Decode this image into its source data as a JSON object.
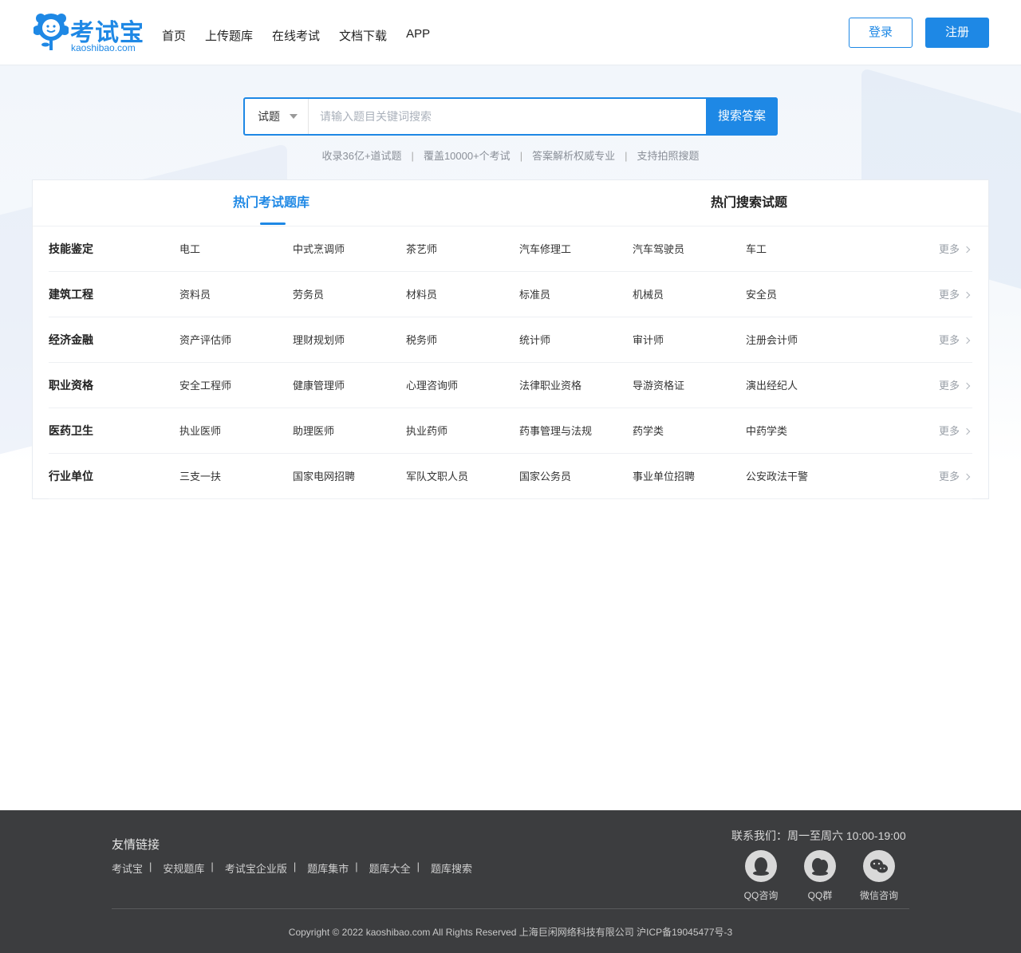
{
  "header": {
    "logo_text": "考试宝",
    "logo_domain": "kaoshibao.com",
    "nav": [
      "首页",
      "上传题库",
      "在线考试",
      "文档下载",
      "APP"
    ],
    "login_label": "登录",
    "register_label": "注册"
  },
  "search": {
    "type_label": "试题",
    "placeholder": "请输入题目关键词搜索",
    "button_label": "搜索答案",
    "features": [
      "收录36亿+道试题",
      "覆盖10000+个考试",
      "答案解析权威专业",
      "支持拍照搜题"
    ],
    "separator": "|"
  },
  "tabs": {
    "active": "热门考试题库",
    "other": "热门搜索试题"
  },
  "more_label": "更多",
  "categories": [
    {
      "title": "技能鉴定",
      "items": [
        "电工",
        "中式烹调师",
        "茶艺师",
        "汽车修理工",
        "汽车驾驶员",
        "车工"
      ]
    },
    {
      "title": "建筑工程",
      "items": [
        "资料员",
        "劳务员",
        "材料员",
        "标准员",
        "机械员",
        "安全员"
      ]
    },
    {
      "title": "经济金融",
      "items": [
        "资产评估师",
        "理财规划师",
        "税务师",
        "统计师",
        "审计师",
        "注册会计师"
      ]
    },
    {
      "title": "职业资格",
      "items": [
        "安全工程师",
        "健康管理师",
        "心理咨询师",
        "法律职业资格",
        "导游资格证",
        "演出经纪人"
      ]
    },
    {
      "title": "医药卫生",
      "items": [
        "执业医师",
        "助理医师",
        "执业药师",
        "药事管理与法规",
        "药学类",
        "中药学类"
      ]
    },
    {
      "title": "行业单位",
      "items": [
        "三支一扶",
        "国家电网招聘",
        "军队文职人员",
        "国家公务员",
        "事业单位招聘",
        "公安政法干警"
      ]
    }
  ],
  "footer": {
    "links_title": "友情链接",
    "links": [
      "考试宝",
      "安规题库",
      "考试宝企业版",
      "题库集市",
      "题库大全",
      "题库搜索"
    ],
    "link_separator": "|",
    "contact": "联系我们：周一至周六 10:00-19:00",
    "social": [
      "QQ咨询",
      "QQ群",
      "微信咨询"
    ],
    "copyright": "Copyright © 2022 kaoshibao.com All Rights Reserved 上海巨闲网络科技有限公司 沪ICP备19045477号-3"
  },
  "colors": {
    "accent": "#1e88e5",
    "footer_bg": "#3c3d3f",
    "hero_bg": "#f2f6fb"
  }
}
